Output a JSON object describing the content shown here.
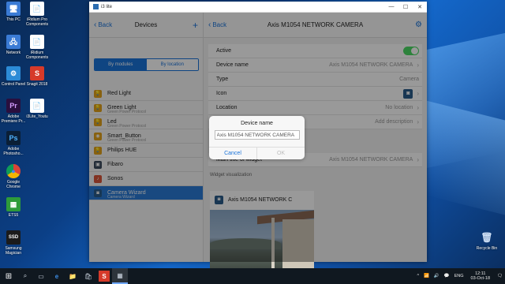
{
  "desktop": {
    "icons": [
      {
        "label": "This PC",
        "glyph": "🖥",
        "color": "#3a7bd5"
      },
      {
        "label": "iRidium Pro Components",
        "glyph": "📄",
        "color": "#ffffff"
      },
      {
        "label": "Network",
        "glyph": "🖧",
        "color": "#3a7bd5"
      },
      {
        "label": "iRidium Components",
        "glyph": "📄",
        "color": "#ffffff"
      },
      {
        "label": "Control Panel",
        "glyph": "⚙",
        "color": "#2c8bd6"
      },
      {
        "label": "Snagit 2018",
        "glyph": "S",
        "color": "#d63a2a"
      },
      {
        "label": "Adobe Premiere Pr...",
        "glyph": "Pr",
        "color": "#2a0f3e"
      },
      {
        "label": "i3Lite_Youtu",
        "glyph": "📄",
        "color": "#ffffff"
      },
      {
        "label": "Adobe Photosho...",
        "glyph": "Ps",
        "color": "#0b1f36"
      },
      {
        "label": "Google Chrome",
        "glyph": "●",
        "color": "#ffffff"
      },
      {
        "label": "ETS5",
        "glyph": "▦",
        "color": "#2e9b3a"
      },
      {
        "label": "Samsung Magician",
        "glyph": "SSD",
        "color": "#1b1b1b"
      },
      {
        "label": "Recycle Bin",
        "glyph": "🗑",
        "color": "#9fb8d6"
      }
    ]
  },
  "window": {
    "title": "i3 lite",
    "controls": [
      "—",
      "☐",
      "✕"
    ]
  },
  "left_pane": {
    "back_label": "Back",
    "title": "Devices",
    "add_label": "+",
    "segments": [
      "By modules",
      "By location"
    ],
    "devices": [
      {
        "name": "Red Light",
        "sub": "",
        "icon": "💡",
        "color": "#e3a21a"
      },
      {
        "name": "Green Light",
        "sub": "Green Power Protocol",
        "icon": "💡",
        "color": "#e3a21a"
      },
      {
        "name": "Led",
        "sub": "Green Power Protocol",
        "icon": "💡",
        "color": "#e3a21a"
      },
      {
        "name": "Smart_Button",
        "sub": "Green Power Protocol",
        "icon": "◉",
        "color": "#e3a21a"
      },
      {
        "name": "Philips HUE",
        "sub": "",
        "icon": "💡",
        "color": "#e3a21a"
      },
      {
        "name": "Fibaro",
        "sub": "",
        "icon": "▣",
        "color": "#3b4a5c"
      },
      {
        "name": "Sonos",
        "sub": "",
        "icon": "♪",
        "color": "#d9563a"
      },
      {
        "name": "Camera Wizard",
        "sub": "Camera Wizard",
        "icon": "◙",
        "color": "#2b5d8a",
        "selected": true
      }
    ]
  },
  "right_pane": {
    "back_label": "Back",
    "title": "Axis M1054 NETWORK CAMERA",
    "gear_label": "⚙",
    "rows": {
      "active_label": "Active",
      "device_name_label": "Device name",
      "device_name_value": "Axis M1054 NETWORK CAMERA",
      "type_label": "Type",
      "type_value": "Camera",
      "icon_label": "Icon",
      "location_label": "Location",
      "location_value": "No location",
      "description_value": "Add description",
      "main_title_label": "Main title of widget"
    },
    "widget_section_title": "Widget visualization",
    "widget_name": "Axis M1054 NETWORK C"
  },
  "dialog": {
    "title": "Device name",
    "input_value": "Axis M1054 NETWORK CAMERA",
    "cancel_label": "Cancel",
    "ok_label": "OK"
  },
  "taskbar": {
    "start": "⊞",
    "search": "⌕",
    "taskview": "▭",
    "apps": [
      "e",
      "📁",
      "🛍",
      "S",
      "▦"
    ],
    "tray_chevron": "^",
    "tray_icons": [
      "📶",
      "🔊",
      "💬"
    ],
    "language": "ENG",
    "time": "12:11",
    "date": "03-Oct-18",
    "notifications": "🗨"
  },
  "colors": {
    "accent": "#1a73d9",
    "selected_row": "#2b7bd6",
    "toggle_on": "#4cd964"
  }
}
